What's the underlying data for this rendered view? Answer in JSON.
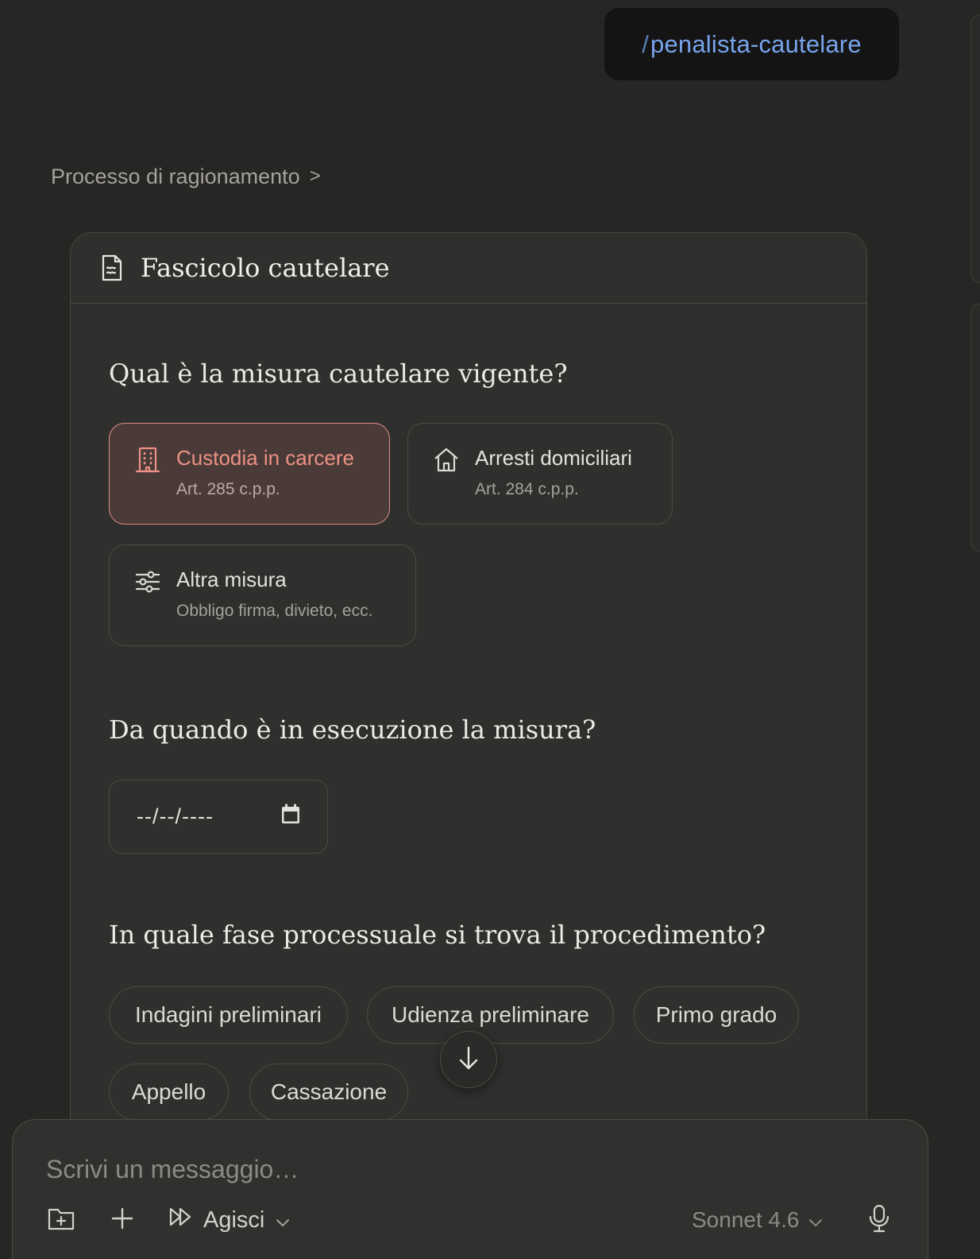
{
  "user_message": {
    "slash": "/",
    "command": "penalista-cautelare"
  },
  "reasoning": {
    "label": "Processo di ragionamento",
    "chevron": ">"
  },
  "card": {
    "title": "Fascicolo cautelare",
    "icon": "document-icon",
    "q1": {
      "question": "Qual è la misura cautelare vigente?",
      "options": [
        {
          "label": "Custodia in carcere",
          "sub": "Art. 285 c.p.p.",
          "icon": "building-icon",
          "selected": true
        },
        {
          "label": "Arresti domiciliari",
          "sub": "Art. 284 c.p.p.",
          "icon": "home-icon",
          "selected": false
        },
        {
          "label": "Altra misura",
          "sub": "Obbligo firma, divieto, ecc.",
          "icon": "sliders-icon",
          "selected": false
        }
      ]
    },
    "q2": {
      "question": "Da quando è in esecuzione la misura?",
      "date_value": "--/--/----",
      "icon": "calendar-icon"
    },
    "q3": {
      "question": "In quale fase processuale si trova il procedimento?",
      "chips": [
        "Indagini preliminari",
        "Udienza preliminare",
        "Primo grado",
        "Appello",
        "Cassazione"
      ]
    }
  },
  "composer": {
    "placeholder": "Scrivi un messaggio…",
    "mode_label": "Agisci",
    "model_label": "Sonnet 4.6"
  },
  "colors": {
    "background": "#262624",
    "card": "#2f2f2d",
    "accent_selected": "#ec9185",
    "command_blue": "#78a4ec"
  }
}
